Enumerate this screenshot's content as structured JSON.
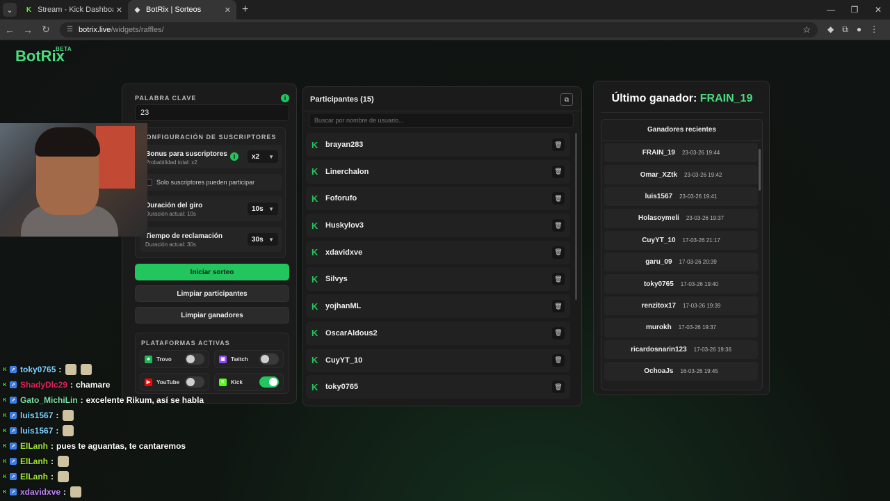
{
  "browser": {
    "tabs": [
      {
        "title": "Stream - Kick Dashboard",
        "active": false
      },
      {
        "title": "BotRix | Sorteos",
        "active": true
      }
    ],
    "url_host": "botrix.live",
    "url_path": "/widgets/raffles/"
  },
  "brand": {
    "name": "BotRix",
    "beta": "BETA"
  },
  "config": {
    "keyword_label": "PALABRA CLAVE",
    "keyword_value": "23",
    "subs_label": "CONFIGURACIÓN DE SUSCRIPTORES",
    "bonus_title": "Bonus para suscriptores",
    "bonus_sub": "Probabilidad total: x2",
    "bonus_value": "x2",
    "subs_only_label": "Solo suscriptores pueden participar",
    "spin_title": "Duración del giro",
    "spin_sub": "Duración actual: 10s",
    "spin_value": "10s",
    "claim_title": "Tiempo de reclamación",
    "claim_sub": "Duración actual: 30s",
    "claim_value": "30s",
    "start_button": "Iniciar sorteo",
    "clear_participants_button": "Limpiar participantes",
    "clear_winners_button": "Limpiar ganadores",
    "platforms_label": "PLATAFORMAS ACTIVAS",
    "platforms": [
      {
        "name": "Trovo",
        "enabled": false,
        "color": "#1db954"
      },
      {
        "name": "Twitch",
        "enabled": false,
        "color": "#9146ff"
      },
      {
        "name": "YouTube",
        "enabled": false,
        "color": "#ff0000"
      },
      {
        "name": "Kick",
        "enabled": true,
        "color": "#53fc18"
      }
    ]
  },
  "participants": {
    "title": "Participantes (15)",
    "search_placeholder": "Buscar por nombre de usuario...",
    "list": [
      "brayan283",
      "Linerchalon",
      "Foforufo",
      "Huskylov3",
      "xdavidxve",
      "Silvys",
      "yojhanML",
      "OscarAldous2",
      "CuyYT_10",
      "toky0765"
    ]
  },
  "winners": {
    "last_winner_label": "Último ganador:",
    "last_winner_name": "FRAIN_19",
    "recent_title": "Ganadores recientes",
    "list": [
      {
        "name": "FRAIN_19",
        "date": "23-03-26 19:44"
      },
      {
        "name": "Omar_XZtk",
        "date": "23-03-26 19:42"
      },
      {
        "name": "luis1567",
        "date": "23-03-26 19:41"
      },
      {
        "name": "Holasoymeli",
        "date": "23-03-26 19:37"
      },
      {
        "name": "CuyYT_10",
        "date": "17-03-26 21:17"
      },
      {
        "name": "garu_09",
        "date": "17-03-26 20:39"
      },
      {
        "name": "toky0765",
        "date": "17-03-26 19:40"
      },
      {
        "name": "renzitox17",
        "date": "17-03-26 19:39"
      },
      {
        "name": "murokh",
        "date": "17-03-26 19:37"
      },
      {
        "name": "ricardosnarin123",
        "date": "17-03-26 19:36"
      },
      {
        "name": "OchoaJs",
        "date": "16-03-26 19:45"
      }
    ]
  },
  "chat": [
    {
      "user": "toky0765",
      "color": "#7fd3ff",
      "msg": "",
      "emotes": 2
    },
    {
      "user": "ShadyDlc29",
      "color": "#e0245e",
      "msg": "chamare",
      "emotes": 0
    },
    {
      "user": "Gato_MichiLin",
      "color": "#7ee2a8",
      "msg": "excelente Rikum, así se habla",
      "emotes": 0
    },
    {
      "user": "luis1567",
      "color": "#7fd3ff",
      "msg": "",
      "emotes": 1
    },
    {
      "user": "luis1567",
      "color": "#7fd3ff",
      "msg": "",
      "emotes": 1
    },
    {
      "user": "ElLanh",
      "color": "#a3e635",
      "msg": "pues te aguantas, te cantaremos",
      "emotes": 0
    },
    {
      "user": "ElLanh",
      "color": "#a3e635",
      "msg": "",
      "emotes": 1
    },
    {
      "user": "ElLanh",
      "color": "#a3e635",
      "msg": "",
      "emotes": 1
    },
    {
      "user": "xdavidxve",
      "color": "#c084fc",
      "msg": "",
      "emotes": 1
    }
  ]
}
